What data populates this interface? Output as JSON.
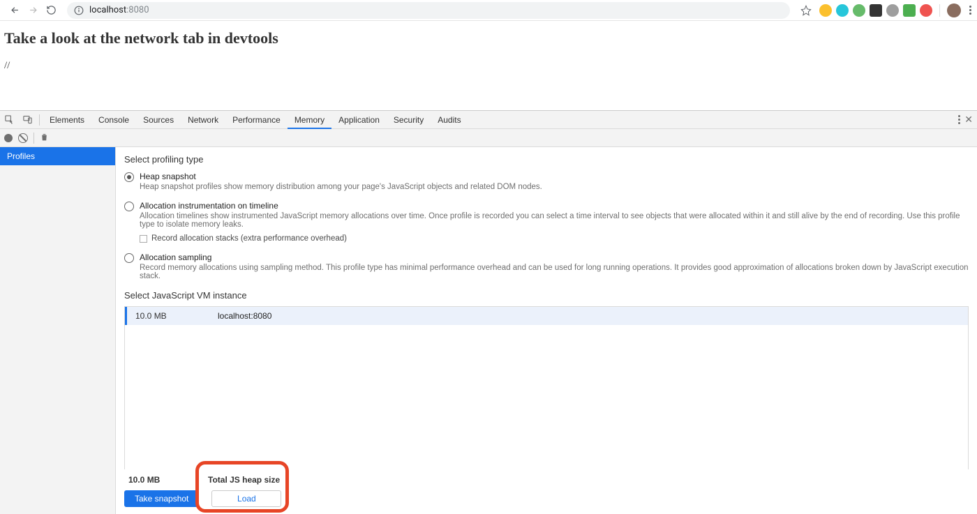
{
  "chrome": {
    "url_host": "localhost",
    "url_port": ":8080",
    "extensions_colors": [
      "#fbc02d",
      "#26c6da",
      "#66bb6a",
      "#333333",
      "#9e9e9e",
      "#4caf50",
      "#ef5350"
    ]
  },
  "page": {
    "heading": "Take a look at the network tab in devtools",
    "body_text": "//"
  },
  "devtools": {
    "tabs": [
      "Elements",
      "Console",
      "Sources",
      "Network",
      "Performance",
      "Memory",
      "Application",
      "Security",
      "Audits"
    ],
    "active_tab_index": 5,
    "sidebar_tabs": [
      "Profiles"
    ]
  },
  "memory": {
    "profiling_section_title": "Select profiling type",
    "options": [
      {
        "title": "Heap snapshot",
        "desc": "Heap snapshot profiles show memory distribution among your page's JavaScript objects and related DOM nodes.",
        "selected": true
      },
      {
        "title": "Allocation instrumentation on timeline",
        "desc": "Allocation timelines show instrumented JavaScript memory allocations over time. Once profile is recorded you can select a time interval to see objects that were allocated within it and still alive by the end of recording. Use this profile type to isolate memory leaks.",
        "selected": false,
        "suboption": "Record allocation stacks (extra performance overhead)"
      },
      {
        "title": "Allocation sampling",
        "desc": "Record memory allocations using sampling method. This profile type has minimal performance overhead and can be used for long running operations. It provides good approximation of allocations broken down by JavaScript execution stack.",
        "selected": false
      }
    ],
    "vm_section_title": "Select JavaScript VM instance",
    "vm_instances": [
      {
        "mem": "10.0 MB",
        "name": "localhost:8080"
      }
    ],
    "footer": {
      "heap_size": "10.0 MB",
      "heap_label": "Total JS heap size",
      "take_snapshot_label": "Take snapshot",
      "load_label": "Load"
    }
  }
}
